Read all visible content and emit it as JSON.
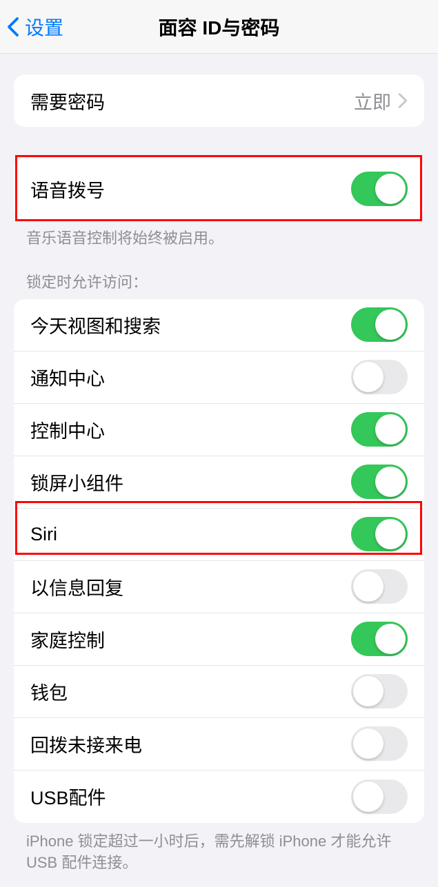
{
  "header": {
    "back_label": "设置",
    "title": "面容 ID与密码"
  },
  "passcode_section": {
    "require_passcode_label": "需要密码",
    "require_passcode_value": "立即"
  },
  "voice_dial": {
    "label": "语音拨号",
    "on": true,
    "footer": "音乐语音控制将始终被启用。"
  },
  "locked_access": {
    "header": "锁定时允许访问：",
    "items": [
      {
        "label": "今天视图和搜索",
        "on": true
      },
      {
        "label": "通知中心",
        "on": false
      },
      {
        "label": "控制中心",
        "on": true
      },
      {
        "label": "锁屏小组件",
        "on": true
      },
      {
        "label": "Siri",
        "on": true
      },
      {
        "label": "以信息回复",
        "on": false
      },
      {
        "label": "家庭控制",
        "on": true
      },
      {
        "label": "钱包",
        "on": false
      },
      {
        "label": "回拨未接来电",
        "on": false
      },
      {
        "label": "USB配件",
        "on": false
      }
    ],
    "footer": "iPhone 锁定超过一小时后，需先解锁 iPhone 才能允许USB 配件连接。"
  }
}
